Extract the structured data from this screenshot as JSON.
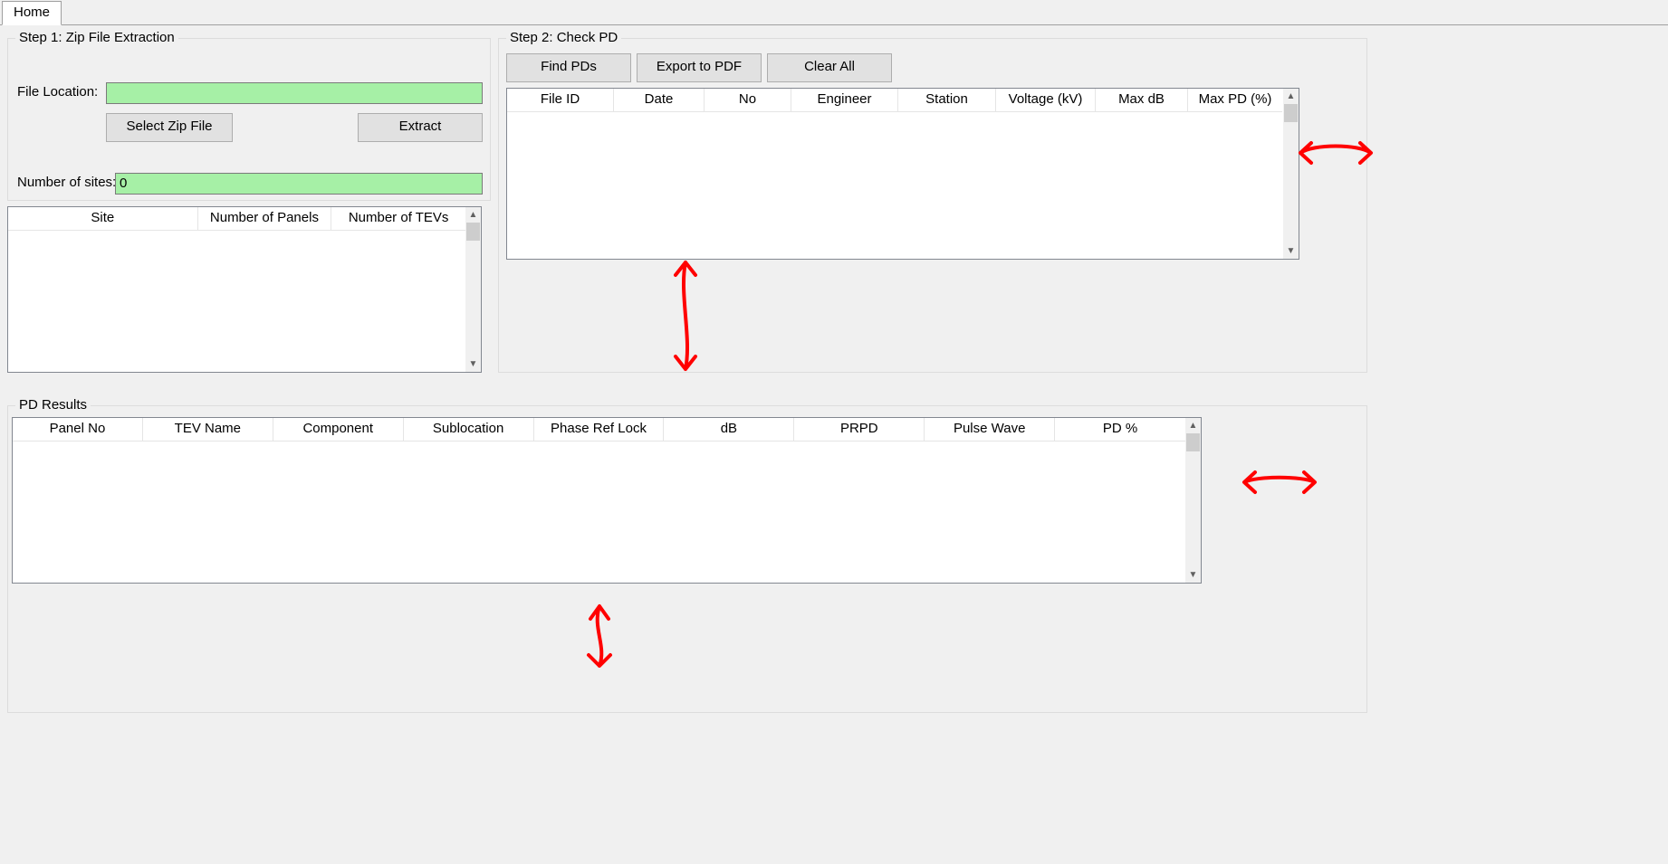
{
  "tabs": {
    "home": "Home"
  },
  "step1": {
    "legend": "Step 1: Zip File Extraction",
    "file_location_label": "File Location:",
    "file_location_value": "",
    "select_zip_button": "Select Zip File",
    "extract_button": "Extract",
    "num_sites_label": "Number of sites:",
    "num_sites_value": "0"
  },
  "sites_table": {
    "columns": [
      "Site",
      "Number of Panels",
      "Number of TEVs"
    ]
  },
  "step2": {
    "legend": "Step 2: Check PD",
    "find_pds_button": "Find PDs",
    "export_pdf_button": "Export to PDF",
    "clear_all_button": "Clear All",
    "columns": [
      "File ID",
      "Date",
      "No",
      "Engineer",
      "Station",
      "Voltage (kV)",
      "Max dB",
      "Max PD (%)"
    ]
  },
  "results": {
    "legend": "PD Results",
    "columns": [
      "Panel No",
      "TEV Name",
      "Component",
      "Sublocation",
      "Phase Ref Lock",
      "dB",
      "PRPD",
      "Pulse Wave",
      "PD %"
    ]
  }
}
